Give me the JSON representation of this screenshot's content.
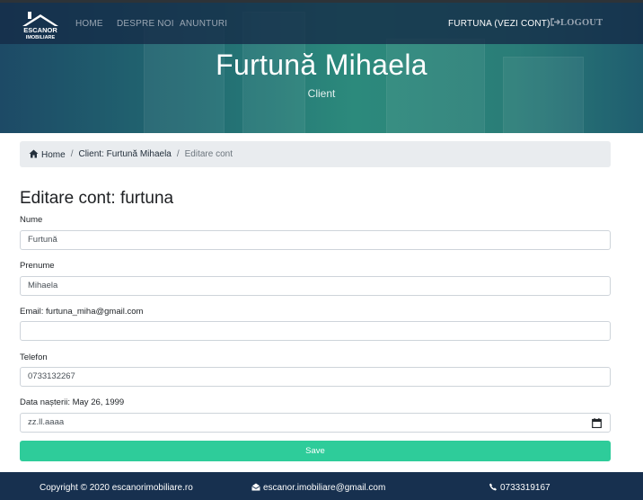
{
  "nav": {
    "logo_text_top": "ESCANOR",
    "logo_text_bottom": "IMOBILIARE",
    "items": [
      {
        "label": "HOME"
      },
      {
        "label": "DESPRE NOI"
      },
      {
        "label": "ANUNTURI"
      }
    ],
    "account_label": "FURTUNA (VEZI CONT)",
    "logout_label": "LOGOUT"
  },
  "hero": {
    "title": "Furtună Mihaela",
    "subtitle": "Client"
  },
  "breadcrumb": {
    "home": "Home",
    "client": "Client: Furtună Mihaela",
    "current": "Editare cont"
  },
  "form": {
    "heading": "Editare cont: furtuna",
    "fields": [
      {
        "label": "Nume",
        "value": "Furtună"
      },
      {
        "label": "Prenume",
        "value": "Mihaela"
      },
      {
        "label": "Email: furtuna_miha@gmail.com",
        "value": ""
      },
      {
        "label": "Telefon",
        "value": "0733132267"
      },
      {
        "label": "Data nașterii: May 26, 1999",
        "value": "zz.ll.aaaa"
      }
    ],
    "save_label": "Save"
  },
  "footer": {
    "copyright": "Copyright © 2020 escanorimobiliare.ro",
    "email": "escanor.imobiliare@gmail.com",
    "phone": "0733319167"
  },
  "colors": {
    "navbar": "#142a46",
    "hero_accent": "#2c8a7c",
    "save_button": "#2ecc9a",
    "footer": "#17304f",
    "breadcrumb_bg": "#e9ecef"
  },
  "icons": [
    "home-icon",
    "calendar-icon",
    "logout-icon",
    "envelope-icon",
    "phone-icon"
  ]
}
